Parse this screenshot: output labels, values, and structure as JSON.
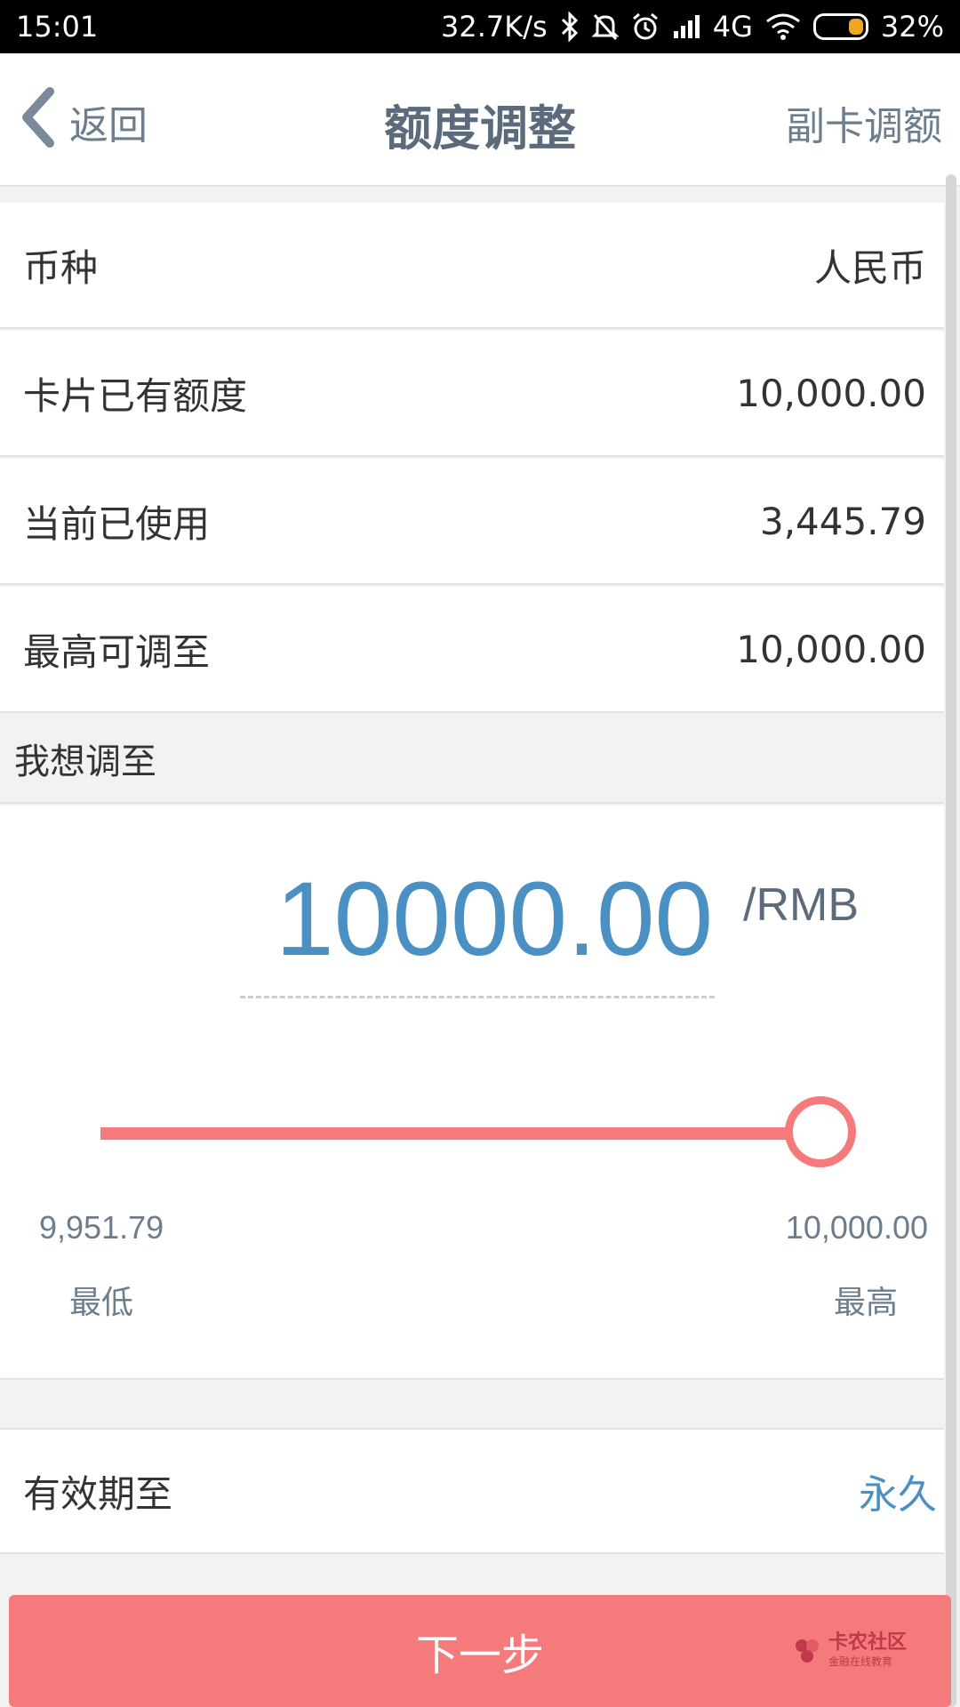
{
  "status_bar": {
    "time": "15:01",
    "network_speed": "32.7K/s",
    "network_type": "4G",
    "battery": "32%",
    "battery_level": 0.32,
    "icons": [
      "bluetooth-icon",
      "mute-bell-icon",
      "alarm-icon",
      "signal-icon",
      "wifi-icon",
      "battery-icon"
    ]
  },
  "header": {
    "back_label": "返回",
    "title": "额度调整",
    "right_link": "副卡调额"
  },
  "rows": [
    {
      "label": "币种",
      "value": "人民币"
    },
    {
      "label": "卡片已有额度",
      "value": "10,000.00"
    },
    {
      "label": "当前已使用",
      "value": "3,445.79"
    },
    {
      "label": "最高可调至",
      "value": "10,000.00"
    }
  ],
  "adjust": {
    "section_label": "我想调至",
    "amount": "10000.00",
    "unit": "/RMB",
    "slider_fraction": 1.0,
    "min_value": "9,951.79",
    "min_label": "最低",
    "max_value": "10,000.00",
    "max_label": "最高"
  },
  "validity": {
    "label": "有效期至",
    "value": "永久"
  },
  "next_button": "下一步",
  "watermark": {
    "title": "卡农社区",
    "subtitle": "金融在线教育"
  },
  "colors": {
    "accent_blue": "#4a90c2",
    "accent_red": "#f47a7c",
    "header_gray": "#5b6b7b"
  }
}
